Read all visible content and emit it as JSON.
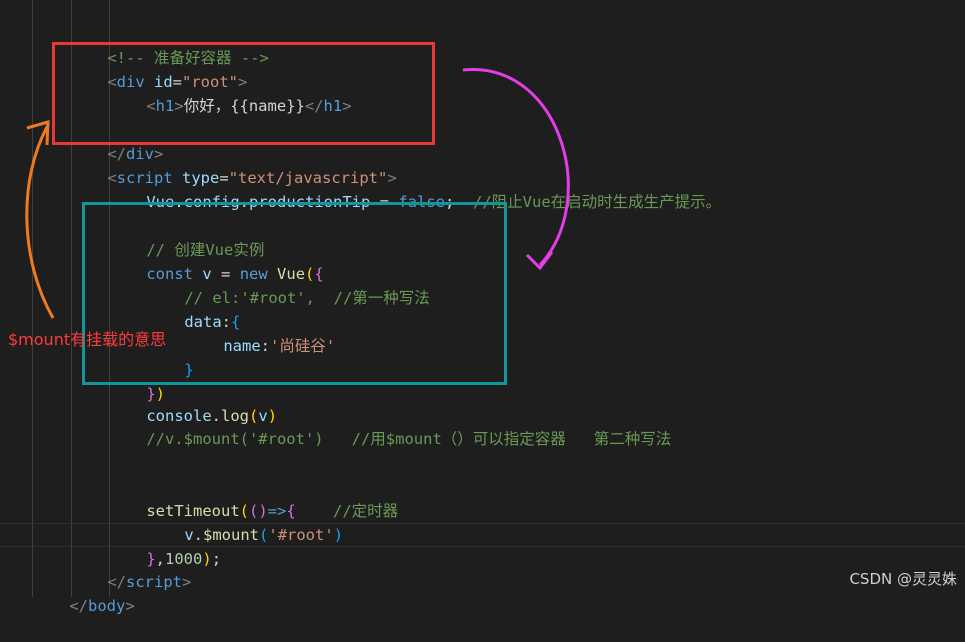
{
  "code": {
    "line1": {
      "comment": "<!-- 准备好容器 -->"
    },
    "line2": {
      "open": "<",
      "tag": "div",
      "attr": " id",
      "eq": "=",
      "value": "\"root\"",
      "close": ">"
    },
    "line3": {
      "open": "<",
      "tag": "h1",
      "close": ">",
      "text": "你好，{{name}}",
      "open2": "</",
      "tag2": "h1",
      "close2": ">"
    },
    "line5": {
      "open": "</",
      "tag": "div",
      "close": ">"
    },
    "line6": {
      "open": "<",
      "tag": "script",
      "attr": " type",
      "eq": "=",
      "value": "\"text/javascript\"",
      "close": ">"
    },
    "line7": {
      "obj": "Vue",
      "dot1": ".",
      "prop1": "config",
      "dot2": ".",
      "prop2": "productionTip",
      "op": " = ",
      "kw": "false",
      "semi": ";  ",
      "comment": "//阻止Vue在启动时生成生产提示。"
    },
    "line9": {
      "comment": "// 创建Vue实例"
    },
    "line10": {
      "kw": "const",
      "sp": " ",
      "var": "v",
      "op": " = ",
      "kw2": "new",
      "sp2": " ",
      "cls": "Vue",
      "paren": "(",
      "brace": "{"
    },
    "line11": {
      "comment": "// el:'#root',  //第一种写法"
    },
    "line12": {
      "prop": "data",
      "colon": ":",
      "brace": "{"
    },
    "line13": {
      "prop": "name",
      "colon": ":",
      "value": "'尚硅谷'"
    },
    "line14": {
      "brace": "}"
    },
    "line15": {
      "brace": "}",
      "paren": ")"
    },
    "line16": {
      "obj": "console",
      "dot": ".",
      "fn": "log",
      "paren": "(",
      "var": "v",
      "paren2": ")"
    },
    "line17": {
      "comment": "//v.$mount('#root')   //用$mount（）可以指定容器   第二种写法"
    },
    "line20": {
      "fn": "setTimeout",
      "p1": "(",
      "p2": "()",
      "arrow": "=>",
      "brace": "{",
      "sp": "    ",
      "comment": "//定时器"
    },
    "line21": {
      "var": "v",
      "dot": ".",
      "fn": "$mount",
      "paren": "(",
      "value": "'#root'",
      "paren2": ")"
    },
    "line22": {
      "brace": "}",
      "text": ",",
      "num": "1000",
      "paren": ")",
      "semi": ";"
    },
    "line23": {
      "open": "</",
      "tag": "script",
      "close": ">"
    },
    "line24": {
      "open": "</",
      "tag": "body",
      "close": ">"
    }
  },
  "annotation": {
    "text": "$mount有挂载的意思",
    "color": "#ff3b3b"
  },
  "watermark": "CSDN @灵灵姝",
  "colors": {
    "red_box": "#e53935",
    "teal_box": "#14959a",
    "magenta_arrow": "#e23de6",
    "orange_arrow": "#f07a1e"
  }
}
